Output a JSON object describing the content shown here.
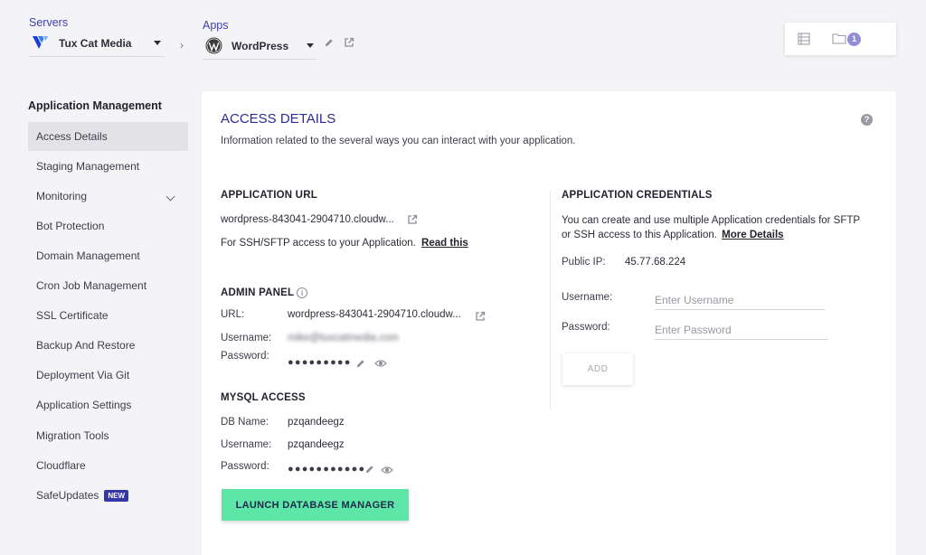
{
  "top": {
    "servers_label": "Servers",
    "server_name": "Tux Cat Media",
    "apps_label": "Apps",
    "app_name": "WordPress",
    "breadcrumb_sep": "›",
    "notification_count": "1"
  },
  "sidebar": {
    "title": "Application Management",
    "items": [
      {
        "label": "Access Details"
      },
      {
        "label": "Staging Management"
      },
      {
        "label": "Monitoring"
      },
      {
        "label": "Bot Protection"
      },
      {
        "label": "Domain Management"
      },
      {
        "label": "Cron Job Management"
      },
      {
        "label": "SSL Certificate"
      },
      {
        "label": "Backup And Restore"
      },
      {
        "label": "Deployment Via Git"
      },
      {
        "label": "Application Settings"
      },
      {
        "label": "Migration Tools"
      },
      {
        "label": "Cloudflare"
      },
      {
        "label": "SafeUpdates"
      }
    ],
    "new_badge": "NEW"
  },
  "main": {
    "title": "ACCESS DETAILS",
    "subtitle": "Information related to the several ways you can interact with your application.",
    "help": "?",
    "app_url": {
      "title": "APPLICATION URL",
      "url": "wordpress-843041-2904710.cloudw...",
      "ssh_text": "For SSH/SFTP access to your Application.",
      "ssh_link": "Read this"
    },
    "admin_panel": {
      "title": "ADMIN PANEL",
      "info": "i",
      "url_label": "URL:",
      "url_value": "wordpress-843041-2904710.cloudw...",
      "username_label": "Username:",
      "username_value": "mike@tuxcatmedia.com",
      "password_label": "Password:",
      "password_value": "●●●●●●●●●"
    },
    "mysql": {
      "title": "MYSQL ACCESS",
      "db_label": "DB Name:",
      "db_value": "pzqandeegz",
      "username_label": "Username:",
      "username_value": "pzqandeegz",
      "password_label": "Password:",
      "password_value": "●●●●●●●●●●●",
      "launch_button": "LAUNCH DATABASE MANAGER"
    },
    "credentials": {
      "title": "APPLICATION CREDENTIALS",
      "desc_line1": "You can create and use multiple Application credentials for SFTP",
      "desc_line2": "or SSH access to this Application.",
      "more_link": "More Details",
      "ip_label": "Public IP:",
      "ip_value": "45.77.68.224",
      "username_label": "Username:",
      "username_placeholder": "Enter Username",
      "password_label": "Password:",
      "password_placeholder": "Enter Password",
      "add_button": "ADD"
    }
  }
}
